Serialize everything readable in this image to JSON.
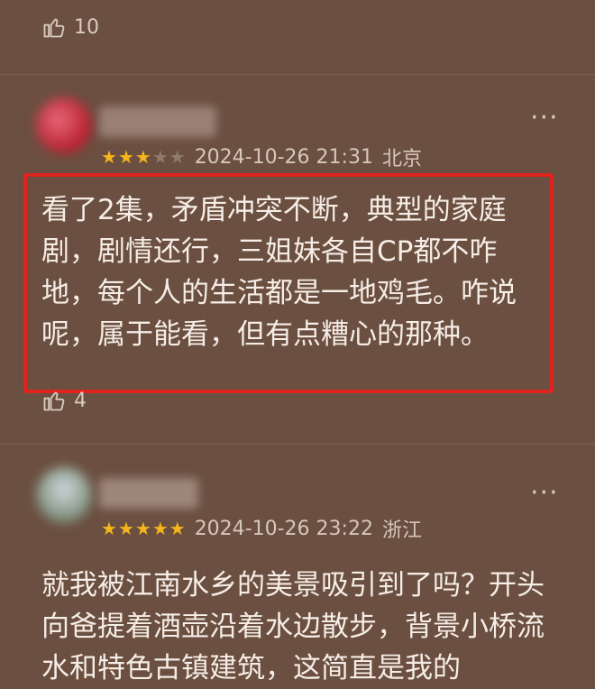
{
  "comments": [
    {
      "likes": "10"
    },
    {
      "rating": 3,
      "date": "2024-10-26 21:31",
      "location": "北京",
      "text": "看了2集，矛盾冲突不断，典型的家庭剧，剧情还行，三姐妹各自CP都不咋地，每个人的生活都是一地鸡毛。咋说呢，属于能看，但有点糟心的那种。",
      "likes": "4"
    },
    {
      "rating": 5,
      "date": "2024-10-26 23:22",
      "location": "浙江",
      "text": "就我被江南水乡的美景吸引到了吗？开头向爸提着酒壶沿着水边散步，背景小桥流水和特色古镇建筑，这简直是我的"
    }
  ],
  "icons": {
    "like": "thumbs-up-icon",
    "more": "more-icon"
  },
  "colors": {
    "background": "#6b4f40",
    "star": "#f4b51d",
    "highlight": "#e0231f"
  }
}
